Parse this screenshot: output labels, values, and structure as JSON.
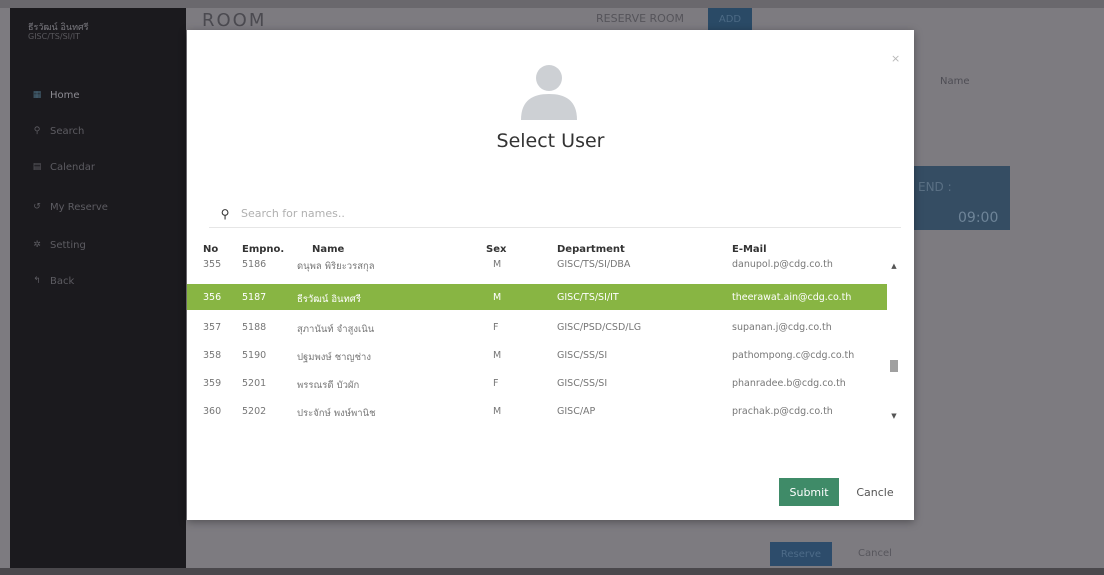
{
  "sidebar": {
    "user_name": "ธีรวัฒน์ อินทศรี",
    "user_dept": "GISC/TS/SI/IT",
    "items": [
      {
        "label": "Home",
        "icon": "grid-icon"
      },
      {
        "label": "Search",
        "icon": "search-icon"
      },
      {
        "label": "Calendar",
        "icon": "calendar-icon"
      },
      {
        "label": "My Reserve",
        "icon": "history-icon"
      },
      {
        "label": "Setting",
        "icon": "gear-icon"
      },
      {
        "label": "Back",
        "icon": "reply-icon"
      }
    ]
  },
  "background": {
    "page_title": "ROOM",
    "reserve_room_label": "RESERVE ROOM",
    "reserve_room_button": "ADD",
    "name_header": "Name",
    "end_label": "END :",
    "end_time": "09:00",
    "reserve_button": "Reserve",
    "cancel_button": "Cancel"
  },
  "modal": {
    "title": "Select User",
    "close_symbol": "×",
    "search_placeholder": "Search for names..",
    "columns": {
      "no": "No",
      "empno": "Empno.",
      "name": "Name",
      "sex": "Sex",
      "department": "Department",
      "email": "E-Mail"
    },
    "rows": [
      {
        "no": "355",
        "empno": "5186",
        "name": "ดนุพล พิริยะวรสกุล",
        "sex": "M",
        "department": "GISC/TS/SI/DBA",
        "email": "danupol.p@cdg.co.th"
      },
      {
        "no": "356",
        "empno": "5187",
        "name": "ธีรวัฒน์ อินทศรี",
        "sex": "M",
        "department": "GISC/TS/SI/IT",
        "email": "theerawat.ain@cdg.co.th"
      },
      {
        "no": "357",
        "empno": "5188",
        "name": "สุภานันท์ จำสูงเนิน",
        "sex": "F",
        "department": "GISC/PSD/CSD/LG",
        "email": "supanan.j@cdg.co.th"
      },
      {
        "no": "358",
        "empno": "5190",
        "name": "ปฐมพงษ์ ชาญช่าง",
        "sex": "M",
        "department": "GISC/SS/SI",
        "email": "pathompong.c@cdg.co.th"
      },
      {
        "no": "359",
        "empno": "5201",
        "name": "พรรณรดี บัวผัก",
        "sex": "F",
        "department": "GISC/SS/SI",
        "email": "phanradee.b@cdg.co.th"
      },
      {
        "no": "360",
        "empno": "5202",
        "name": "ประจักษ์ พงษ์พานิช",
        "sex": "M",
        "department": "GISC/AP",
        "email": "prachak.p@cdg.co.th"
      }
    ],
    "selected_row": "356",
    "submit_label": "Submit",
    "cancel_label": "Cancle"
  },
  "colors": {
    "selected_row": "#88b543",
    "submit_button": "#3f8b68",
    "sidebar_bg": "#1b1a1e"
  }
}
